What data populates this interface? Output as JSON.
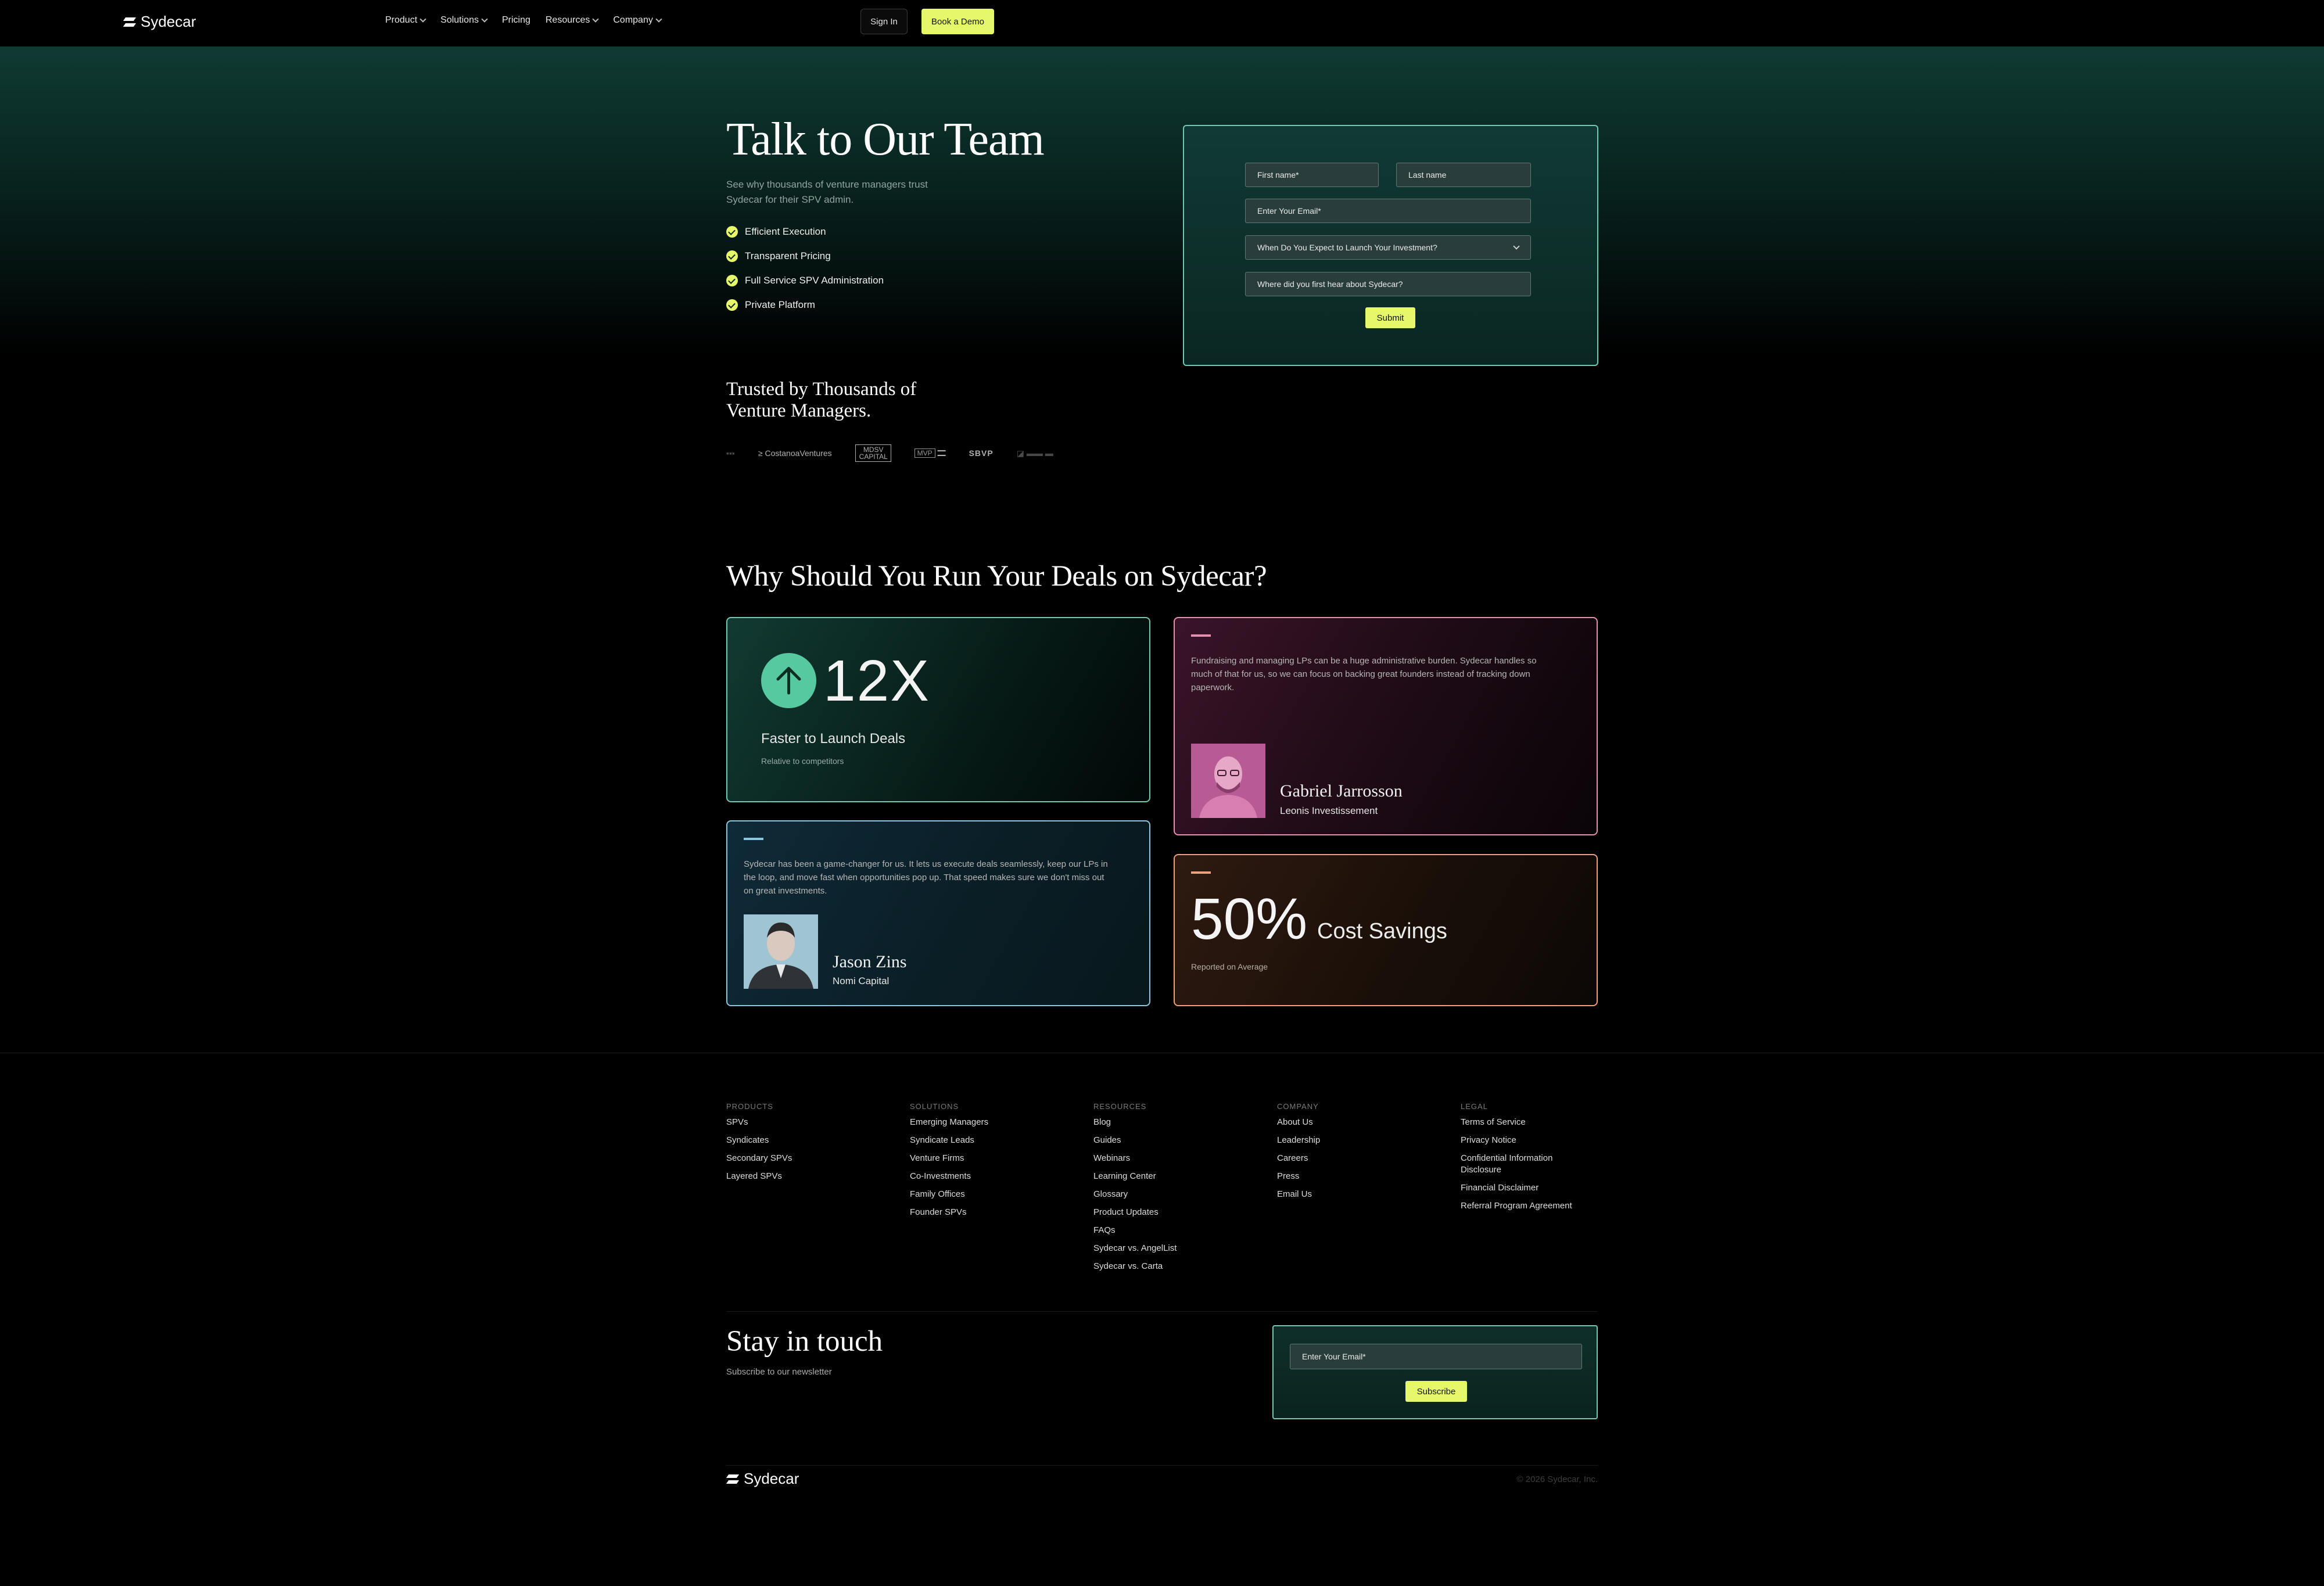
{
  "brand": {
    "name": "Sydecar"
  },
  "nav": {
    "items": [
      "Product",
      "Solutions",
      "Pricing",
      "Resources",
      "Company"
    ],
    "sign_in": "Sign In",
    "book_demo": "Book a Demo"
  },
  "hero": {
    "title": "Talk to Our Team",
    "subtitle": "See why thousands of venture managers trust Sydecar for their SPV admin.",
    "features": [
      "Efficient Execution",
      "Transparent Pricing",
      "Full Service SPV Administration",
      "Private Platform"
    ]
  },
  "form": {
    "first_name_placeholder": "First name*",
    "last_name_placeholder": "Last name",
    "email_placeholder": "Enter Your Email*",
    "launch_select": "When Do You Expect to Launch Your Investment?",
    "source_placeholder": "Where did you first hear about Sydecar?",
    "submit": "Submit"
  },
  "trusted": {
    "title": "Trusted by Thousands of Venture Managers.",
    "logos": [
      "CostanoaVentures",
      "MDSV CAPITAL",
      "MVP",
      "SBVP"
    ]
  },
  "why": {
    "title": "Why Should You Run Your Deals on Sydecar?",
    "stat1": {
      "value": "12X",
      "label": "Faster to Launch Deals",
      "sub": "Relative to competitors"
    },
    "quote1": {
      "text": "Fundraising and managing LPs can be a huge administrative burden. Sydecar handles so much of that for us, so we can focus on backing great founders instead of tracking down paperwork.",
      "name": "Gabriel Jarrosson",
      "company": "Leonis Investissement"
    },
    "quote2": {
      "text": "Sydecar has been a game-changer for us. It lets us execute deals seamlessly, keep our LPs in the loop, and move fast when opportunities pop up. That speed makes sure we don't miss out on great investments.",
      "name": "Jason Zins",
      "company": "Nomi Capital"
    },
    "stat2": {
      "value": "50%",
      "label": "Cost Savings",
      "sub": "Reported on Average"
    }
  },
  "footer": {
    "columns": [
      {
        "head": "PRODUCTS",
        "links": [
          "SPVs",
          "Syndicates",
          "Secondary SPVs",
          "Layered SPVs"
        ]
      },
      {
        "head": "SOLUTIONS",
        "links": [
          "Emerging Managers",
          "Syndicate Leads",
          "Venture Firms",
          "Co-Investments",
          "Family Offices",
          "Founder SPVs"
        ]
      },
      {
        "head": "RESOURCES",
        "links": [
          "Blog",
          "Guides",
          "Webinars",
          "Learning Center",
          "Glossary",
          "Product Updates",
          "FAQs",
          "Sydecar vs. AngelList",
          "Sydecar vs. Carta"
        ]
      },
      {
        "head": "COMPANY",
        "links": [
          "About Us",
          "Leadership",
          "Careers",
          "Press",
          "Email Us"
        ]
      },
      {
        "head": "LEGAL",
        "links": [
          "Terms of Service",
          "Privacy Notice",
          "Confidential Information Disclosure",
          "Financial Disclaimer",
          "Referral Program Agreement"
        ]
      }
    ],
    "stay_title": "Stay in touch",
    "stay_sub": "Subscribe to our newsletter",
    "email_placeholder": "Enter Your Email*",
    "subscribe": "Subscribe",
    "copyright": "© 2026 Sydecar, Inc."
  },
  "colors": {
    "accent": "#e6f86a",
    "teal": "#6fc9b4",
    "pink": "#e78fb0",
    "blue": "#8ec6e0",
    "orange": "#f2a07a"
  },
  "icons": [
    "sydecar-logo-icon",
    "chevron-down-icon",
    "check-icon",
    "arrow-up-icon"
  ]
}
